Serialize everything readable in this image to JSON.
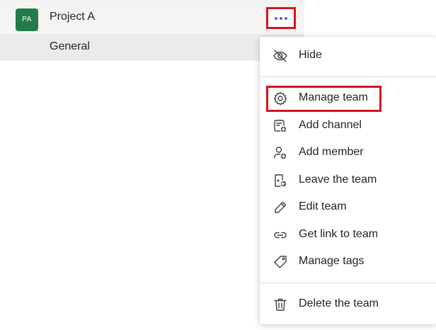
{
  "team": {
    "avatar_initials": "PA",
    "avatar_color": "#237b4b",
    "name": "Project A",
    "channel": "General",
    "more_icon": "more-horizontal-icon"
  },
  "menu": {
    "items": [
      {
        "label": "Hide",
        "icon": "eye-off-icon"
      },
      {
        "label": "Manage team",
        "icon": "gear-icon",
        "highlighted": true
      },
      {
        "label": "Add channel",
        "icon": "add-channel-icon"
      },
      {
        "label": "Add member",
        "icon": "add-person-icon"
      },
      {
        "label": "Leave the team",
        "icon": "leave-team-icon"
      },
      {
        "label": "Edit team",
        "icon": "pencil-icon"
      },
      {
        "label": "Get link to team",
        "icon": "link-icon"
      },
      {
        "label": "Manage tags",
        "icon": "tag-icon"
      },
      {
        "label": "Delete the team",
        "icon": "trash-icon"
      }
    ]
  },
  "colors": {
    "accent": "#5b5fc7",
    "highlight_border": "#d4141f"
  }
}
